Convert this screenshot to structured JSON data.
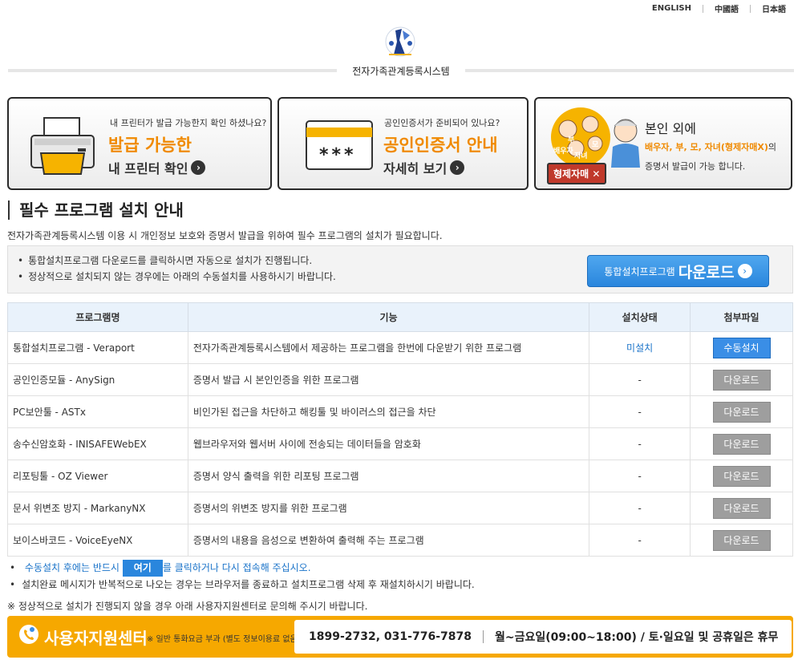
{
  "languages": [
    "ENGLISH",
    "中國語",
    "日本語"
  ],
  "site_title": "전자가족관계등록시스템",
  "banners": [
    {
      "question": "내 프린터가 발급 가능한지 확인 하셨나요?",
      "headline": "발급 가능한",
      "link": "내 프린터 확인"
    },
    {
      "question": "공인인증서가 준비되어 있나요?",
      "headline": "공인인증서 안내",
      "link": "자세히 보기",
      "card_text": "***"
    },
    {
      "title": "본인 외에",
      "highlight": "배우자, 부, 모, 자녀(형제자매X)",
      "suffix": "의",
      "desc": "증명서 발급이 가능 합니다.",
      "badge": "형제자매 ✕",
      "faces": [
        "부",
        "모",
        "배우자",
        "자녀"
      ]
    }
  ],
  "section": {
    "title": "필수 프로그램 설치 안내",
    "desc": "전자가족관계등록시스템 이용 시 개인정보 보호와 증명서 발급을 위하여 필수 프로그램의 설치가 필요합니다."
  },
  "info": {
    "lines": [
      "통합설치프로그램 다운로드를 클릭하시면 자동으로 설치가 진행됩니다.",
      "정상적으로 설치되지 않는 경우에는 아래의 수동설치를 사용하시기 바랍니다."
    ],
    "download_small": "통합설치프로그램",
    "download_big": "다운로드"
  },
  "table": {
    "headers": [
      "프로그램명",
      "기능",
      "설치상태",
      "첨부파일"
    ],
    "rows": [
      {
        "name": "통합설치프로그램 - Veraport",
        "func": "전자가족관계등록시스템에서 제공하는 프로그램을 한번에 다운받기 위한 프로그램",
        "status": "미설치",
        "button": "수동설치"
      },
      {
        "name": "공인인증모듈 - AnySign",
        "func": "증명서 발급 시 본인인증을 위한 프로그램",
        "status": "-",
        "button": "다운로드"
      },
      {
        "name": "PC보안툴 - ASTx",
        "func": "비인가된 접근을 차단하고 해킹툴 및 바이러스의 접근을 차단",
        "status": "-",
        "button": "다운로드"
      },
      {
        "name": "송수신암호화 - INISAFEWebEX",
        "func": "웹브라우저와 웹서버 사이에 전송되는 데이터들을 암호화",
        "status": "-",
        "button": "다운로드"
      },
      {
        "name": "리포팅툴 - OZ Viewer",
        "func": "증명서 양식 출력을 위한 리포팅 프로그램",
        "status": "-",
        "button": "다운로드"
      },
      {
        "name": "문서 위변조 방지 - MarkanyNX",
        "func": "증명서의 위변조 방지를 위한 프로그램",
        "status": "-",
        "button": "다운로드"
      },
      {
        "name": "보이스바코드 - VoiceEyeNX",
        "func": "증명서의 내용을 음성으로 변환하여 출력해 주는 프로그램",
        "status": "-",
        "button": "다운로드"
      }
    ]
  },
  "notes": {
    "n1_pre": "수동설치 후에는 반드시",
    "n1_here": "여기",
    "n1_post": "를 클릭하거나 다시 접속해 주십시오.",
    "n2": "설치완료 메시지가 반복적으로 나오는 경우는 브라우저를 종료하고 설치프로그램 삭제 후 재설치하시기 바랍니다.",
    "warn": "※ 정상적으로 설치가 진행되지 않을 경우 아래 사용자지원센터로 문의해 주시기 바랍니다."
  },
  "support": {
    "name": "사용자지원센터",
    "note": "※ 일반 통화요금 부과 (별도 정보이용료 없음)",
    "phone": "1899-2732, 031-776-7878",
    "hours": "월~금요일(09:00~18:00) / 토·일요일 및 공휴일은 휴무"
  },
  "colors": {
    "accent_orange": "#f08a00",
    "button_blue": "#2a86dd",
    "support_bg": "#f6a800"
  }
}
